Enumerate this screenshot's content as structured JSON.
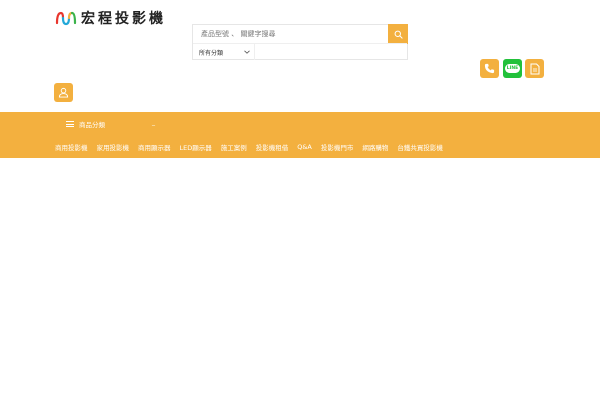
{
  "logo": {
    "text": "宏程投影機",
    "icon": "brand-logo-icon",
    "colors": [
      "#e8362d",
      "#22a8d8",
      "#f3b03f",
      "#3bb34a"
    ]
  },
  "search": {
    "placeholder": "產品型號 、 關鍵字搜尋",
    "category_selected": "所有分類",
    "button_icon": "search-icon"
  },
  "contact": {
    "phone_icon": "phone-icon",
    "line_label": "LINE",
    "doc_icon": "document-icon"
  },
  "account": {
    "icon": "user-icon"
  },
  "nav": {
    "category_menu_label": "商品分類",
    "underscore": "_",
    "links": [
      "商用投影機",
      "家用投影機",
      "商用顯示器",
      "LED顯示器",
      "施工案例",
      "投影機租借",
      "Q&A",
      "投影機門市",
      "網路購物",
      "台鐵共買投影機"
    ]
  },
  "colors": {
    "accent": "#f3b03f",
    "line_green": "#22c13b",
    "background": "#ffffff"
  }
}
